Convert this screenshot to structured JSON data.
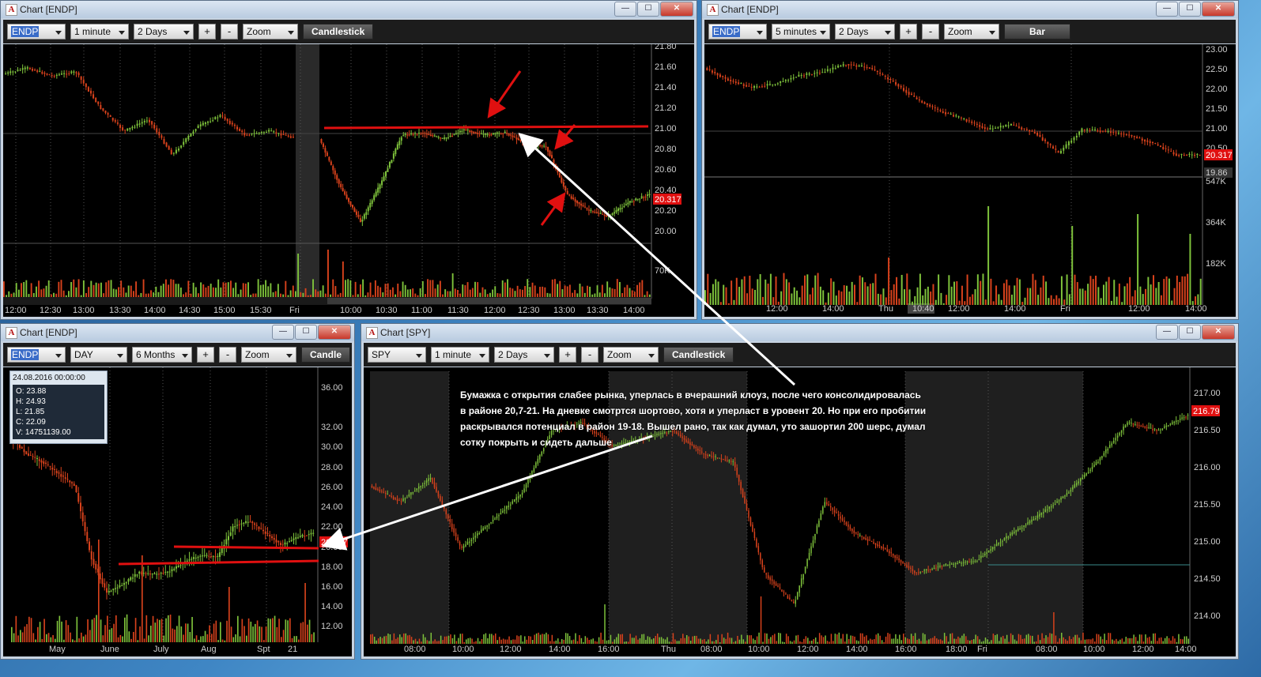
{
  "windows": {
    "top_left": {
      "title": "Chart [ENDP]",
      "symbol": "ENDP",
      "interval": "1 minute",
      "range": "2 Days",
      "plus": "+",
      "minus": "-",
      "zoom": "Zoom",
      "chart_type": "Candlestick",
      "price_labels": [
        "21.80",
        "21.60",
        "21.40",
        "21.20",
        "21.00",
        "20.80",
        "20.60",
        "20.40",
        "20.20",
        "20.00"
      ],
      "last_price": "20.317",
      "volume_label": "70K",
      "time_labels": [
        "12:00",
        "12:30",
        "13:00",
        "13:30",
        "14:00",
        "14:30",
        "15:00",
        "15:30",
        "Fri",
        "10:00",
        "10:30",
        "11:00",
        "11:30",
        "12:00",
        "12:30",
        "13:00",
        "13:30",
        "14:00"
      ]
    },
    "top_right": {
      "title": "Chart [ENDP]",
      "symbol": "ENDP",
      "interval": "5 minutes",
      "range": "2 Days",
      "plus": "+",
      "minus": "-",
      "zoom": "Zoom",
      "chart_type": "Bar",
      "price_labels": [
        "23.00",
        "22.50",
        "22.00",
        "21.50",
        "21.00",
        "20.50"
      ],
      "last_price": "20.317",
      "prev_price": "19.86",
      "volume_labels": [
        "547K",
        "364K",
        "182K"
      ],
      "time_labels": [
        "12:00",
        "14:00",
        "Thu",
        "10:40",
        "12:00",
        "14:00",
        "Fri",
        "12:00",
        "14:00"
      ]
    },
    "bottom_left": {
      "title": "Chart [ENDP]",
      "symbol": "ENDP",
      "interval": "DAY",
      "range": "6 Months",
      "plus": "+",
      "minus": "-",
      "zoom": "Zoom",
      "chart_type": "Candle",
      "price_labels": [
        "36.00",
        "32.00",
        "30.00",
        "28.00",
        "26.00",
        "24.00",
        "22.00",
        "20.00",
        "18.00",
        "16.00",
        "14.00",
        "12.00"
      ],
      "last_price": "20.317",
      "time_labels": [
        "May",
        "June",
        "July",
        "Aug",
        "Spt",
        "21"
      ],
      "ohlc": {
        "date": "24.08.2016 00:00:00",
        "open": "O: 23.88",
        "high": "H: 24.93",
        "low": "L: 21.85",
        "close": "C: 22.09",
        "volume": "V: 14751139.00"
      }
    },
    "bottom_right": {
      "title": "Chart [SPY]",
      "symbol": "SPY",
      "interval": "1 minute",
      "range": "2 Days",
      "plus": "+",
      "minus": "-",
      "zoom": "Zoom",
      "chart_type": "Candlestick",
      "price_labels": [
        "217.00",
        "216.50",
        "216.00",
        "215.50",
        "215.00",
        "214.50",
        "214.00"
      ],
      "last_price": "216.79",
      "time_labels": [
        "08:00",
        "10:00",
        "12:00",
        "14:00",
        "16:00",
        "Thu",
        "08:00",
        "10:00",
        "12:00",
        "14:00",
        "16:00",
        "18:00",
        "Fri",
        "08:00",
        "10:00",
        "12:00",
        "14:00"
      ]
    }
  },
  "window_buttons": {
    "minimize": "—",
    "maximize": "☐",
    "close": "✕"
  },
  "annotation": {
    "line1": "Бумажка с открытия слабее рынка, уперлась в вчерашний клоуз, после чего консолидировалась",
    "line2": "в районе 20,7-21. На дневке смотртся шортово, хотя и уперласт в уровент 20. Но при его пробитии",
    "line3": "раскрывался потенциал в район 19-18. Вышел рано, так как думал, уто зашортил 200 шерс, думал",
    "line4": "сотку покрыть и сидеть дальше"
  },
  "colors": {
    "up": "#7ec23b",
    "down": "#d8421c",
    "level_line": "#e01010",
    "arrow": "#ffffff"
  }
}
